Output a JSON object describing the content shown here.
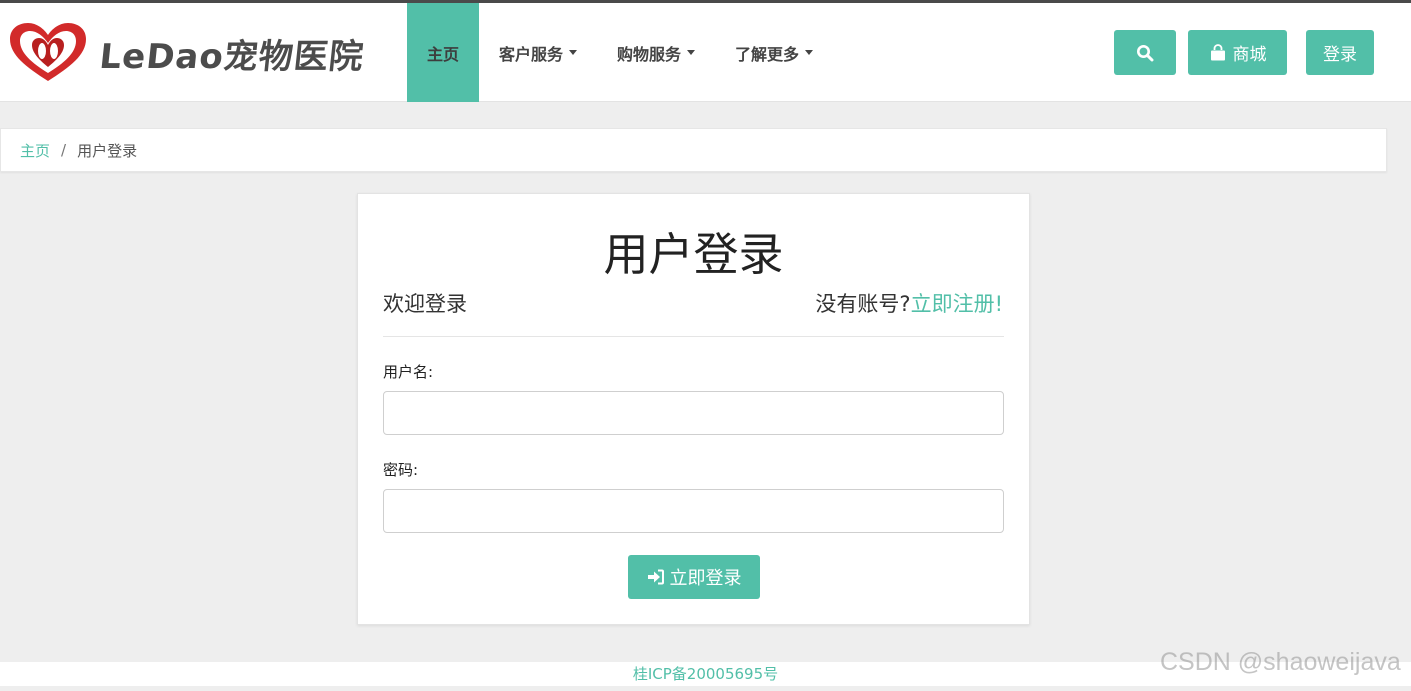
{
  "brand": {
    "logo_icon": "heart-logo-icon",
    "name": "LeDao宠物医院",
    "accent": "#cc2a2a"
  },
  "nav": {
    "items": [
      {
        "label": "主页",
        "active": true,
        "dropdown": false
      },
      {
        "label": "客户服务",
        "active": false,
        "dropdown": true
      },
      {
        "label": "购物服务",
        "active": false,
        "dropdown": true
      },
      {
        "label": "了解更多",
        "active": false,
        "dropdown": true
      }
    ],
    "search_icon": "search-icon",
    "shop_icon": "shopping-bag-icon",
    "shop_label": "商城",
    "login_label": "登录"
  },
  "breadcrumb": {
    "home": "主页",
    "separator": "/",
    "current": "用户登录"
  },
  "login": {
    "title": "用户登录",
    "welcome": "欢迎登录",
    "no_account": "没有账号?",
    "register_link": "立即注册!",
    "username_label": "用户名:",
    "username_value": "",
    "password_label": "密码:",
    "password_value": "",
    "submit_icon": "sign-in-icon",
    "submit_label": "立即登录"
  },
  "footer": {
    "icp": "桂ICP备20005695号"
  },
  "watermark": "CSDN @shaoweijava",
  "colors": {
    "primary": "#52bfa8",
    "background": "#eeeeee",
    "text": "#333333"
  }
}
